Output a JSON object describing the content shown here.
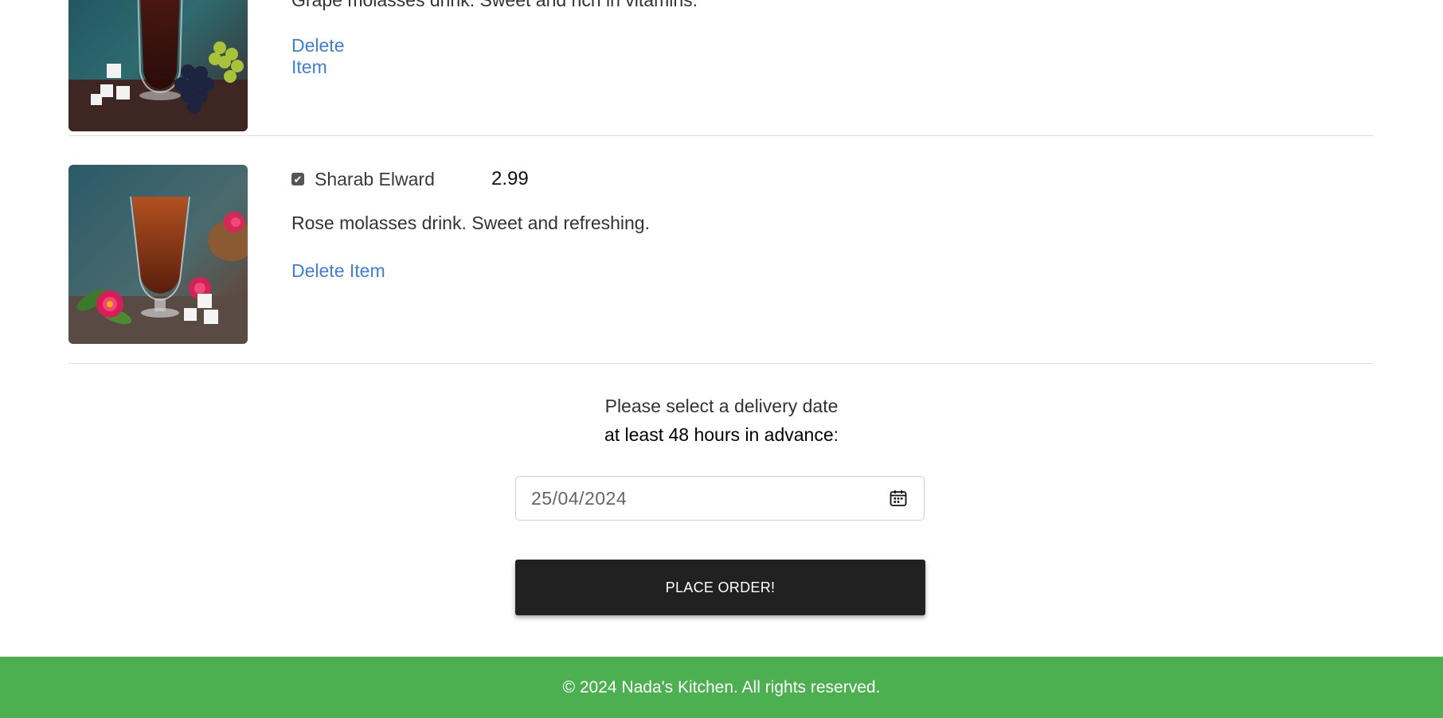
{
  "cart": {
    "items": [
      {
        "name": "",
        "price": "",
        "description": "Grape molasses drink. Sweet and rich in vitamins.",
        "delete_label": "Delete Item",
        "checked": true
      },
      {
        "name": "Sharab Elward",
        "price": "2.99",
        "description": "Rose molasses drink. Sweet and refreshing.",
        "delete_label": "Delete Item",
        "checked": true
      }
    ]
  },
  "delivery": {
    "prompt_line1": "Please select a delivery date",
    "prompt_line2_strong": "at least 48 hours in advance",
    "prompt_line2_suffix": ":",
    "date_value": "25/04/2024",
    "calendar_icon": "calendar-icon"
  },
  "order": {
    "button_label": "PLACE ORDER!"
  },
  "footer": {
    "text": "© 2024 Nada's Kitchen. All rights reserved."
  },
  "colors": {
    "link": "#3f7fd6",
    "button_bg": "#212121",
    "footer_bg": "#4caf50"
  }
}
